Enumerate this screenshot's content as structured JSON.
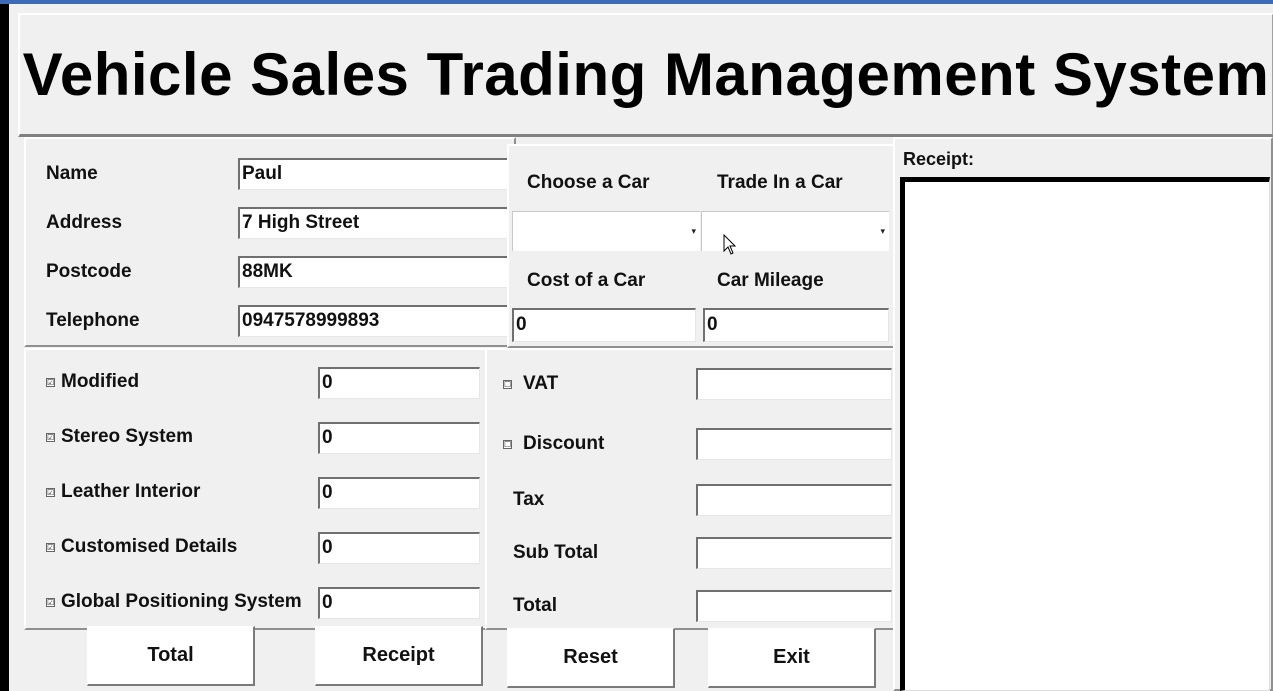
{
  "title": "Vehicle Sales Trading Management System",
  "customer": {
    "name_label": "Name",
    "name_value": "Paul",
    "address_label": "Address",
    "address_value": "7 High Street",
    "postcode_label": "Postcode",
    "postcode_value": "88MK",
    "telephone_label": "Telephone",
    "telephone_value": "0947578999893"
  },
  "car": {
    "choose_label": "Choose a Car",
    "choose_value": "",
    "trade_label": "Trade In a Car",
    "trade_value": "",
    "cost_label": "Cost of a Car",
    "cost_value": "0",
    "mileage_label": "Car Mileage",
    "mileage_value": "0"
  },
  "extras": [
    {
      "label": "Modified",
      "checked": true,
      "value": "0"
    },
    {
      "label": "Stereo System",
      "checked": true,
      "value": "0"
    },
    {
      "label": "Leather Interior",
      "checked": true,
      "value": "0"
    },
    {
      "label": "Customised Details",
      "checked": true,
      "value": "0"
    },
    {
      "label": "Global Positioning System",
      "checked": true,
      "value": "0"
    }
  ],
  "costs": {
    "vat_label": "VAT",
    "vat_checked": false,
    "vat_value": "",
    "discount_label": "Discount",
    "discount_checked": false,
    "discount_value": "",
    "tax_label": "Tax",
    "tax_value": "",
    "subtotal_label": "Sub Total",
    "subtotal_value": "",
    "total_label": "Total",
    "total_value": ""
  },
  "buttons": {
    "total": "Total",
    "receipt": "Receipt",
    "reset": "Reset",
    "exit": "Exit"
  },
  "receipt": {
    "label": "Receipt:",
    "content": ""
  },
  "icons": {
    "checked": "☑",
    "unchecked": "☐",
    "dropdown": "▾"
  }
}
